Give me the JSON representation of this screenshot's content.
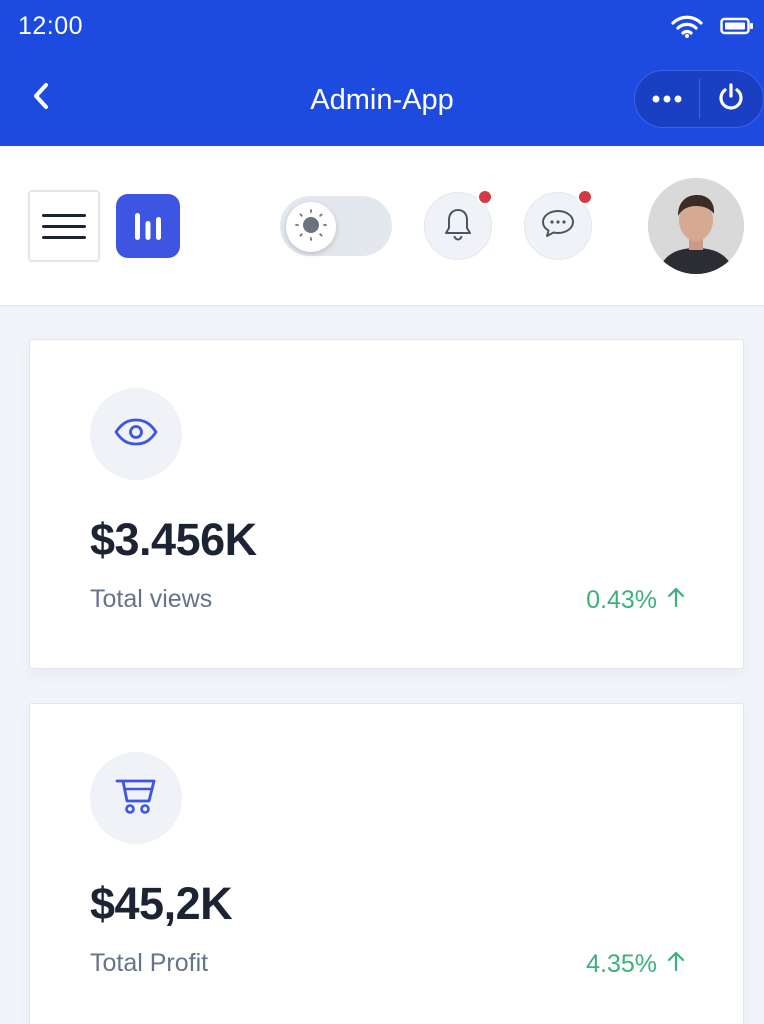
{
  "status_bar": {
    "time": "12:00",
    "icons": [
      "wifi-icon",
      "battery-icon"
    ]
  },
  "app_bar": {
    "title": "Admin-App",
    "icons": [
      "back-icon",
      "more-icon",
      "power-icon"
    ]
  },
  "header": {
    "icons": [
      "menu-icon",
      "chart-logo-icon",
      "sun-icon",
      "bell-icon",
      "chat-icon"
    ],
    "notification_dot_color": "#d43a45",
    "accent_color": "#3d55e0"
  },
  "stats": [
    {
      "icon": "eye-icon",
      "value": "$3.456K",
      "label": "Total views",
      "change": "0.43%",
      "trend": "up"
    },
    {
      "icon": "cart-icon",
      "value": "$45,2K",
      "label": "Total Profit",
      "change": "4.35%",
      "trend": "up"
    }
  ],
  "colors": {
    "app_bar": "#1d4be0",
    "positive": "#3cb179",
    "text_dark": "#1c2434",
    "text_muted": "#64748b"
  }
}
